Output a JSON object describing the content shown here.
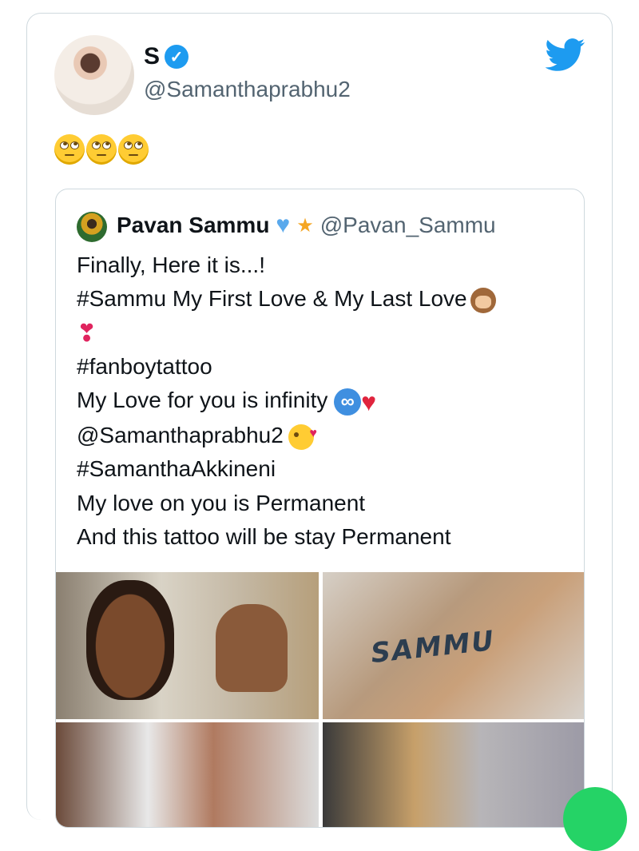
{
  "tweet": {
    "author_name": "S",
    "author_handle": "@Samanthaprabhu2",
    "verified_mark": "✓",
    "body_emoji": "🙄🙄🙄"
  },
  "quoted_tweet": {
    "author_name": "Pavan Sammu",
    "author_handle": "@Pavan_Sammu",
    "name_emoji": "💙💫",
    "lines": [
      "Finally, Here it is...!",
      "#Sammu My First Love & My Last Love",
      "#fanboytattoo",
      "My Love for you is infinity",
      "@Samanthaprabhu2",
      "#SamanthaAkkineni",
      "My love on you is Permanent",
      "And this tattoo will be stay Permanent"
    ],
    "photos": [
      "selfie-photo",
      "tattoo-photo",
      "tattooing-photo-1",
      "tattooing-photo-2"
    ],
    "tattoo_text": "SAMMU"
  },
  "colors": {
    "brand_blue": "#1d9bf0",
    "border": "#cfd9de",
    "secondary_text": "#536471"
  },
  "icons": [
    "twitter-bird-icon",
    "verified-badge-icon"
  ]
}
